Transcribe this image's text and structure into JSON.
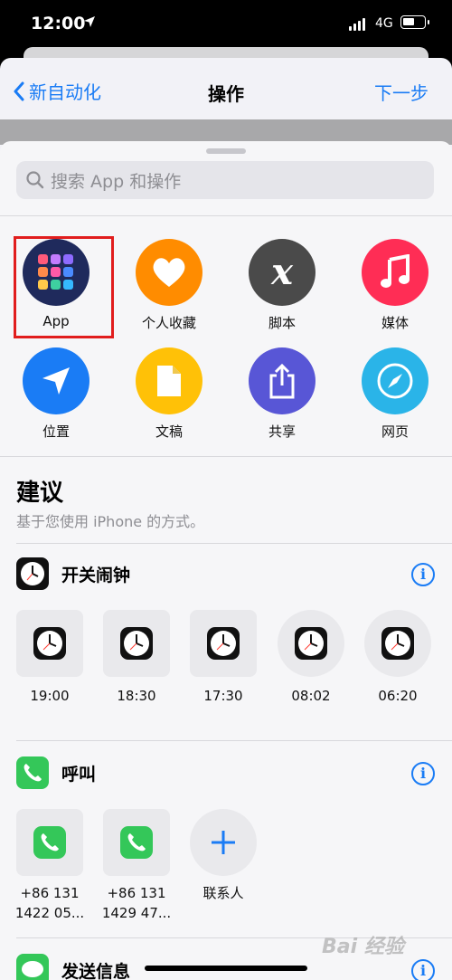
{
  "status_bar": {
    "time": "12:00",
    "network": "4G"
  },
  "nav": {
    "back_label": "新自动化",
    "title": "操作",
    "next_label": "下一步"
  },
  "search": {
    "placeholder": "搜索 App 和操作"
  },
  "categories": [
    {
      "label": "App",
      "icon": "app-grid-icon",
      "color": "#1f2a5c"
    },
    {
      "label": "个人收藏",
      "icon": "heart-icon",
      "color": "#ff8c00"
    },
    {
      "label": "脚本",
      "icon": "script-x-icon",
      "color": "#4a4a4a"
    },
    {
      "label": "媒体",
      "icon": "music-note-icon",
      "color": "#ff2d55"
    },
    {
      "label": "位置",
      "icon": "location-arrow-icon",
      "color": "#1a7cf5"
    },
    {
      "label": "文稿",
      "icon": "document-icon",
      "color": "#ffc107"
    },
    {
      "label": "共享",
      "icon": "share-icon",
      "color": "#5856d6"
    },
    {
      "label": "网页",
      "icon": "compass-icon",
      "color": "#2ab4e8"
    }
  ],
  "suggestions": {
    "title": "建议",
    "subtitle": "基于您使用 iPhone 的方式。"
  },
  "alarm_section": {
    "title": "开关闹钟",
    "items": [
      "19:00",
      "18:30",
      "17:30",
      "08:02",
      "06:20"
    ]
  },
  "call_section": {
    "title": "呼叫",
    "items": [
      {
        "line1": "+86 131",
        "line2": "1422 05..."
      },
      {
        "line1": "+86 131",
        "line2": "1429 47..."
      }
    ],
    "add_label": "联系人"
  },
  "message_section": {
    "title": "发送信息"
  },
  "watermark": "Bai 经验"
}
